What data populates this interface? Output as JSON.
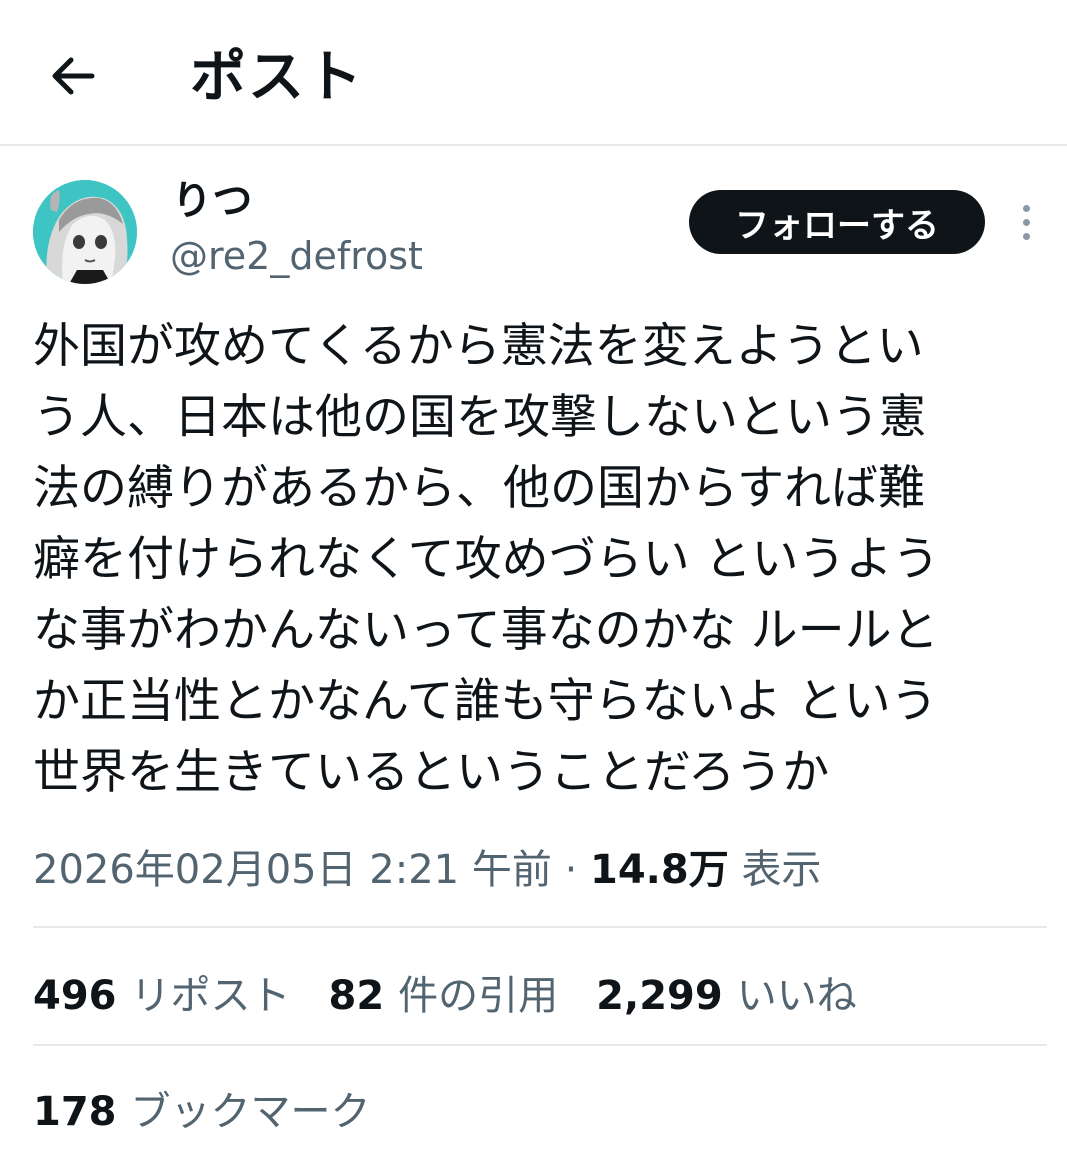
{
  "header": {
    "back_icon": "arrow-left-icon",
    "title": "ポスト"
  },
  "author": {
    "display_name": "りつ",
    "handle": "@re2_defrost",
    "avatar_color": "#3ec4c2"
  },
  "follow_button": {
    "label": "フォローする"
  },
  "more_icon": "more-vertical-icon",
  "tweet": {
    "lines": [
      "外国が攻めてくるから憲法を変えようとい",
      "う人、日本は他の国を攻撃しないという憲",
      "法の縛りがあるから、他の国からすれば難",
      "癖を付けられなくて攻めづらい というよう",
      "な事がわかんないって事なのかな ルールと",
      "か正当性とかなんて誰も守らないよ という",
      "世界を生きているということだろうか"
    ]
  },
  "meta": {
    "timestamp": "2026年02月05日 2:21 午前",
    "separator": " · ",
    "views_count": "14.8万",
    "views_label": "表示"
  },
  "stats": {
    "reposts": {
      "count": "496",
      "label": "リポスト"
    },
    "quotes": {
      "count": "82",
      "label": "件の引用"
    },
    "likes": {
      "count": "2,299",
      "label": "いいね"
    },
    "bookmarks": {
      "count": "178",
      "label": "ブックマーク"
    }
  },
  "colors": {
    "text_primary": "#0f1419",
    "text_secondary": "#536471",
    "divider": "#e6e9eb",
    "follow_bg": "#0f1419"
  }
}
